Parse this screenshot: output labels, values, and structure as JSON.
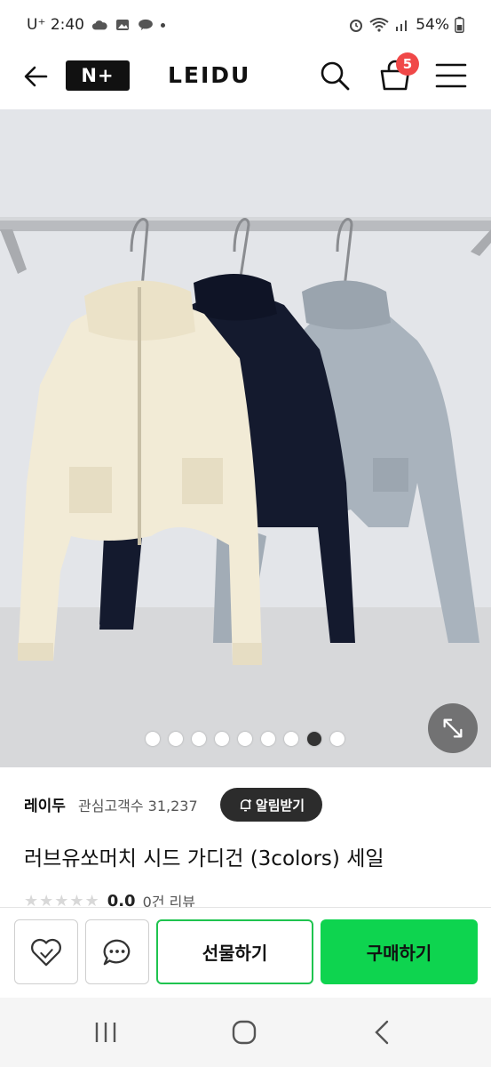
{
  "status_bar": {
    "carrier_time": "U⁺ 2:40",
    "battery": "54%"
  },
  "header": {
    "brand_logo": "N+",
    "store_name": "LEIDU",
    "cart_count": "5",
    "icons": [
      "back-arrow-icon",
      "search-icon",
      "cart-icon",
      "menu-icon"
    ]
  },
  "gallery": {
    "total_images": 9,
    "current_index": 8,
    "expand_icon": "expand-icon"
  },
  "store": {
    "name": "레이두",
    "followers_label": "관심고객수 31,237",
    "follow_button": "알림받기"
  },
  "product": {
    "title": "러브유쏘머치 시드 가디건 (3colors) 세일",
    "rating_value": "0.0",
    "review_count": "0건 리뷰"
  },
  "actions": {
    "gift_label": "선물하기",
    "buy_label": "구매하기",
    "wish_icon": "heart-icon",
    "talk_icon": "chat-bubble-icon"
  },
  "colors": {
    "buy_green": "#0ed44f",
    "gift_border": "#1fc44f",
    "badge_red": "#f04848",
    "follow_dark": "#2c2c2c"
  }
}
